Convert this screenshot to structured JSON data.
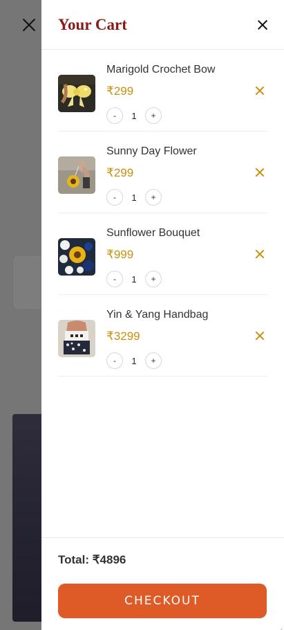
{
  "cart": {
    "title": "Your Cart",
    "items": [
      {
        "name": "Marigold Crochet Bow",
        "price": "₹299",
        "qty": "1",
        "minus": "-",
        "plus": "+"
      },
      {
        "name": "Sunny Day Flower",
        "price": "₹299",
        "qty": "1",
        "minus": "-",
        "plus": "+"
      },
      {
        "name": "Sunflower Bouquet",
        "price": "₹999",
        "qty": "1",
        "minus": "-",
        "plus": "+"
      },
      {
        "name": "Yin & Yang Handbag",
        "price": "₹3299",
        "qty": "1",
        "minus": "-",
        "plus": "+"
      }
    ],
    "total_label": "Total: ₹4896",
    "checkout_label": "CHECKOUT"
  },
  "colors": {
    "title": "#8b1a1a",
    "price": "#c9900f",
    "checkout": "#de5a26"
  },
  "icons": {
    "close": "close-icon",
    "remove": "remove-icon"
  }
}
